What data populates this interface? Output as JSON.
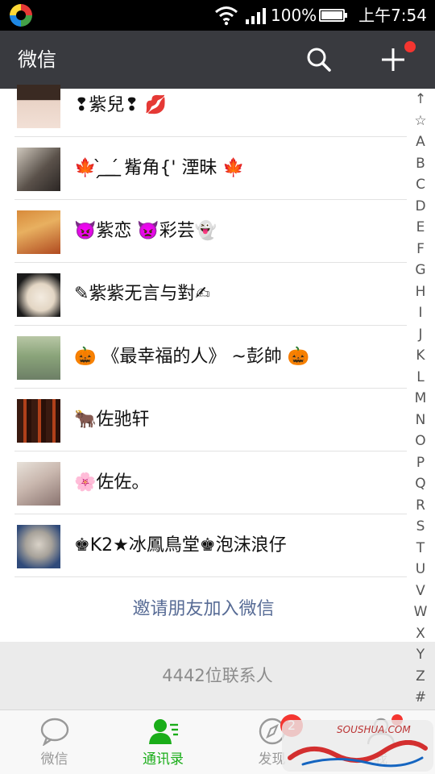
{
  "status_bar": {
    "battery": "100%",
    "time": "上午7:54"
  },
  "header": {
    "title": "微信",
    "search_icon": "search-icon",
    "add_icon": "plus-icon"
  },
  "contacts": [
    {
      "name": "❢紫兒❢ 💋"
    },
    {
      "name": "🍁 ̗̀ ͟ ͟ ́  觜角{' 湮昧 🍁"
    },
    {
      "name": "👿紫恋 👿彩芸👻"
    },
    {
      "name": "✎紫紫无言与對✍"
    },
    {
      "name": "🎃 《最幸福的人》 ~彭帥 🎃"
    },
    {
      "name": "🐂佐驰轩"
    },
    {
      "name": "🌸佐佐。"
    },
    {
      "name": "♚K2★冰鳳鳥堂♚泡沫浪仔"
    }
  ],
  "invite_label": "邀请朋友加入微信",
  "contact_count": "4442位联系人",
  "alphabet_index": [
    "↑",
    "☆",
    "A",
    "B",
    "C",
    "D",
    "E",
    "F",
    "G",
    "H",
    "I",
    "J",
    "K",
    "L",
    "M",
    "N",
    "O",
    "P",
    "Q",
    "R",
    "S",
    "T",
    "U",
    "V",
    "W",
    "X",
    "Y",
    "Z",
    "#"
  ],
  "tabs": [
    {
      "label": "微信",
      "icon": "chat-bubble-icon",
      "active": false
    },
    {
      "label": "通讯录",
      "icon": "contacts-icon",
      "active": true
    },
    {
      "label": "发现",
      "icon": "compass-icon",
      "active": false
    },
    {
      "label": "我",
      "icon": "person-icon",
      "active": false
    }
  ],
  "discover_badge": "2",
  "watermark_text": "SOUSHUA.COM",
  "colors": {
    "header_bg": "#393a3f",
    "accent_green": "#1aad19",
    "badge_red": "#f43530",
    "link_blue": "#576b95"
  }
}
